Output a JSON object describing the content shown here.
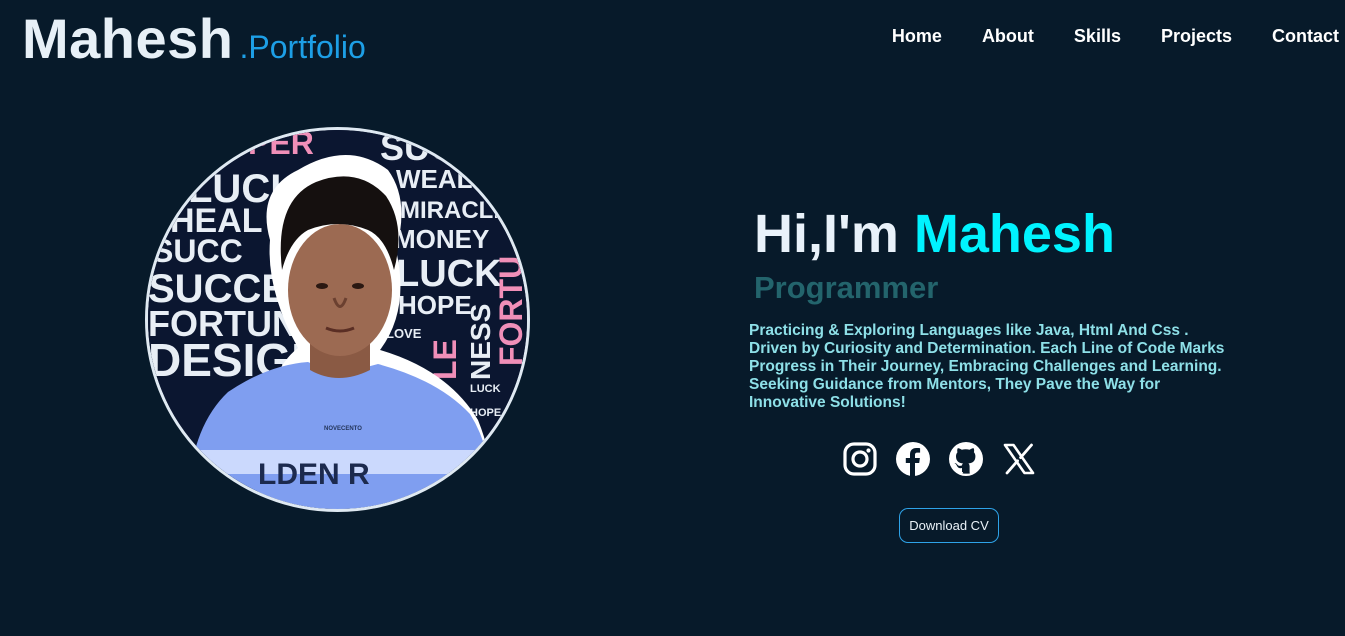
{
  "brand": {
    "name": "Mahesh",
    "suffix": ".Portfolio"
  },
  "nav": {
    "items": [
      "Home",
      "About",
      "Skills",
      "Projects",
      "Contact"
    ]
  },
  "hero": {
    "greeting": "Hi,I'm",
    "name": "Mahesh",
    "role": "Programmer",
    "bio": "Practicing & Exploring Languages like Java, Html And Css . Driven by Curiosity and Determination. Each Line of Code Marks Progress in Their Journey, Embracing Challenges and Learning. Seeking Guidance from Mentors, They Pave the Way for Innovative Solutions!",
    "cv_label": "Download CV"
  },
  "photo_text": {
    "w1": "SUC",
    "w2": "PER",
    "w3": "LUCK",
    "w4": "WEALT",
    "w5": "HEAL",
    "w6": "MIRACLE",
    "w7": "SUCC",
    "w8": "MONEY",
    "w9": "SUCCE",
    "w10": "LUCK",
    "w11": "HOPE",
    "w12": "FORTUN",
    "w13": "DESIGN",
    "w14": "LOVE",
    "w15": "LUCK",
    "w16": "HOPE",
    "w17": "FORTU",
    "w18": "NESS",
    "w19": "LE",
    "shirt1": "NOVECENTO",
    "shirt2": "LDEN R"
  },
  "socials": [
    {
      "name": "Instagram",
      "icon": "instagram-icon"
    },
    {
      "name": "Facebook",
      "icon": "facebook-icon"
    },
    {
      "name": "GitHub",
      "icon": "github-icon"
    },
    {
      "name": "X",
      "icon": "x-icon"
    }
  ],
  "colors": {
    "background": "#071a2a",
    "accent": "#00f3ff",
    "brand_blue": "#1d9fe6",
    "role": "#23646c",
    "bio": "#8ee0e8"
  }
}
